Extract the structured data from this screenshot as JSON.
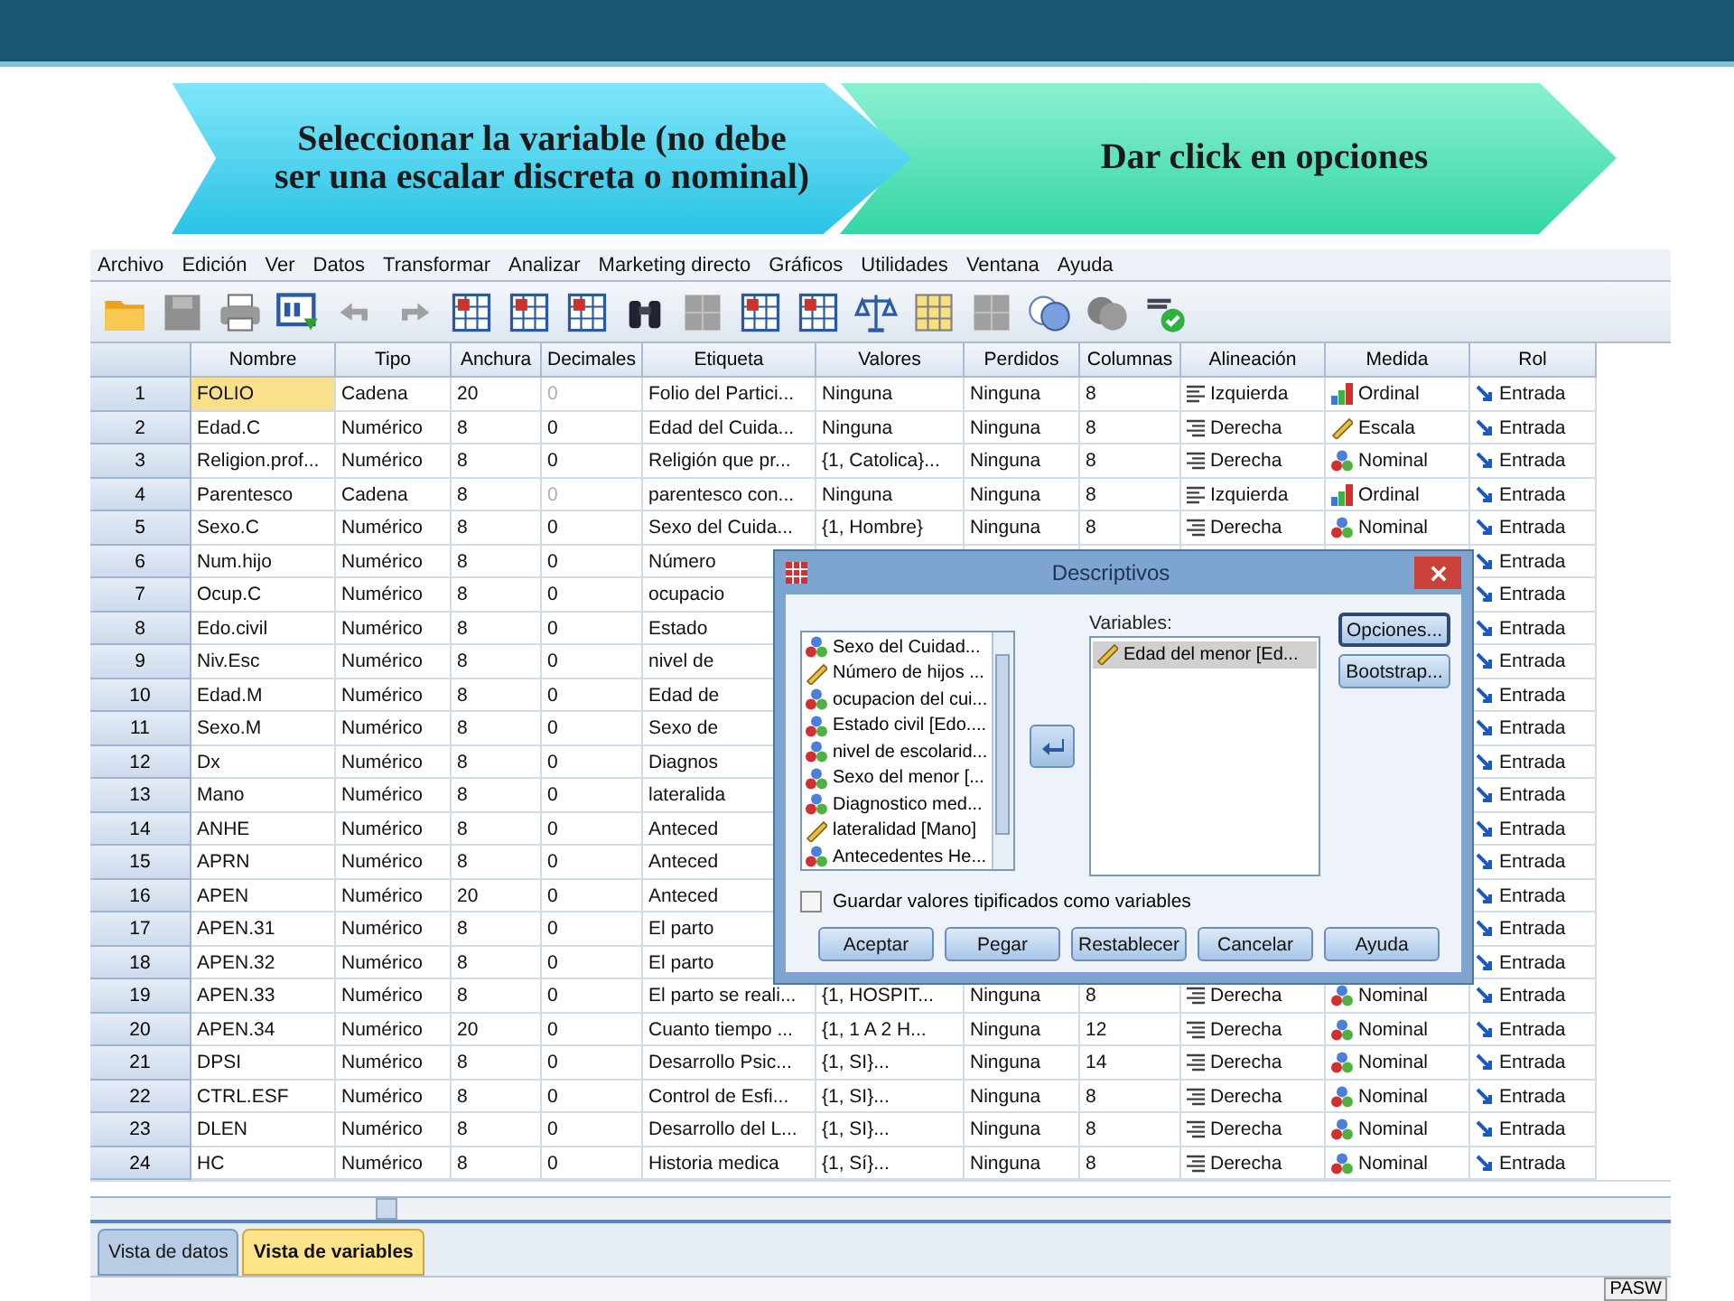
{
  "slide": {
    "steps": [
      {
        "text": "Seleccionar la variable (no debe ser una escalar discreta o nominal)",
        "kind": "cyan"
      },
      {
        "text": "Dar click en opciones",
        "kind": "green"
      }
    ]
  },
  "menu": [
    "Archivo",
    "Edición",
    "Ver",
    "Datos",
    "Transformar",
    "Analizar",
    "Marketing directo",
    "Gráficos",
    "Utilidades",
    "Ventana",
    "Ayuda"
  ],
  "table": {
    "columns": [
      "Nombre",
      "Tipo",
      "Anchura",
      "Decimales",
      "Etiqueta",
      "Valores",
      "Perdidos",
      "Columnas",
      "Alineación",
      "Medida",
      "Rol"
    ],
    "rows": [
      {
        "number": "1",
        "selected": true,
        "nombre": "FOLIO",
        "tipo": "Cadena",
        "anchura": "20",
        "decimales": {
          "text": "0",
          "dimmed": true
        },
        "etiqueta": "Folio del Partici...",
        "valores": "Ninguna",
        "perdidos": "Ninguna",
        "columnas": "8",
        "alineacion": {
          "text": "Izquierda",
          "kind": "left"
        },
        "medida": {
          "text": "Ordinal",
          "kind": "ordinal"
        },
        "rol": "Entrada"
      },
      {
        "number": "2",
        "selected": false,
        "nombre": "Edad.C",
        "tipo": "Numérico",
        "anchura": "8",
        "decimales": {
          "text": "0",
          "dimmed": false
        },
        "etiqueta": "Edad del Cuida...",
        "valores": "Ninguna",
        "perdidos": "Ninguna",
        "columnas": "8",
        "alineacion": {
          "text": "Derecha",
          "kind": "right"
        },
        "medida": {
          "text": "Escala",
          "kind": "scale"
        },
        "rol": "Entrada"
      },
      {
        "number": "3",
        "selected": false,
        "nombre": "Religion.prof...",
        "tipo": "Numérico",
        "anchura": "8",
        "decimales": {
          "text": "0",
          "dimmed": false
        },
        "etiqueta": "Religión que pr...",
        "valores": "{1, Catolica}...",
        "perdidos": "Ninguna",
        "columnas": "8",
        "alineacion": {
          "text": "Derecha",
          "kind": "right"
        },
        "medida": {
          "text": "Nominal",
          "kind": "nominal"
        },
        "rol": "Entrada"
      },
      {
        "number": "4",
        "selected": false,
        "nombre": "Parentesco",
        "tipo": "Cadena",
        "anchura": "8",
        "decimales": {
          "text": "0",
          "dimmed": true
        },
        "etiqueta": "parentesco con...",
        "valores": "Ninguna",
        "perdidos": "Ninguna",
        "columnas": "8",
        "alineacion": {
          "text": "Izquierda",
          "kind": "left"
        },
        "medida": {
          "text": "Ordinal",
          "kind": "ordinal"
        },
        "rol": "Entrada"
      },
      {
        "number": "5",
        "selected": false,
        "nombre": "Sexo.C",
        "tipo": "Numérico",
        "anchura": "8",
        "decimales": {
          "text": "0",
          "dimmed": false
        },
        "etiqueta": "Sexo del Cuida...",
        "valores": "{1, Hombre}",
        "perdidos": "Ninguna",
        "columnas": "8",
        "alineacion": {
          "text": "Derecha",
          "kind": "right"
        },
        "medida": {
          "text": "Nominal",
          "kind": "nominal"
        },
        "rol": "Entrada"
      },
      {
        "number": "6",
        "selected": false,
        "nombre": "Num.hijo",
        "tipo": "Numérico",
        "anchura": "8",
        "decimales": {
          "text": "0",
          "dimmed": false
        },
        "etiqueta": "Número",
        "rol": "Entrada"
      },
      {
        "number": "7",
        "selected": false,
        "nombre": "Ocup.C",
        "tipo": "Numérico",
        "anchura": "8",
        "decimales": {
          "text": "0",
          "dimmed": false
        },
        "etiqueta": "ocupacio",
        "rol": "Entrada"
      },
      {
        "number": "8",
        "selected": false,
        "nombre": "Edo.civil",
        "tipo": "Numérico",
        "anchura": "8",
        "decimales": {
          "text": "0",
          "dimmed": false
        },
        "etiqueta": "Estado",
        "rol": "Entrada"
      },
      {
        "number": "9",
        "selected": false,
        "nombre": "Niv.Esc",
        "tipo": "Numérico",
        "anchura": "8",
        "decimales": {
          "text": "0",
          "dimmed": false
        },
        "etiqueta": "nivel de",
        "rol": "Entrada"
      },
      {
        "number": "10",
        "selected": false,
        "nombre": "Edad.M",
        "tipo": "Numérico",
        "anchura": "8",
        "decimales": {
          "text": "0",
          "dimmed": false
        },
        "etiqueta": "Edad de",
        "rol": "Entrada"
      },
      {
        "number": "11",
        "selected": false,
        "nombre": "Sexo.M",
        "tipo": "Numérico",
        "anchura": "8",
        "decimales": {
          "text": "0",
          "dimmed": false
        },
        "etiqueta": "Sexo de",
        "rol": "Entrada"
      },
      {
        "number": "12",
        "selected": false,
        "nombre": "Dx",
        "tipo": "Numérico",
        "anchura": "8",
        "decimales": {
          "text": "0",
          "dimmed": false
        },
        "etiqueta": "Diagnos",
        "rol": "Entrada"
      },
      {
        "number": "13",
        "selected": false,
        "nombre": "Mano",
        "tipo": "Numérico",
        "anchura": "8",
        "decimales": {
          "text": "0",
          "dimmed": false
        },
        "etiqueta": "lateralida",
        "rol": "Entrada"
      },
      {
        "number": "14",
        "selected": false,
        "nombre": "ANHE",
        "tipo": "Numérico",
        "anchura": "8",
        "decimales": {
          "text": "0",
          "dimmed": false
        },
        "etiqueta": "Anteced",
        "rol": "Entrada"
      },
      {
        "number": "15",
        "selected": false,
        "nombre": "APRN",
        "tipo": "Numérico",
        "anchura": "8",
        "decimales": {
          "text": "0",
          "dimmed": false
        },
        "etiqueta": "Anteced",
        "rol": "Entrada"
      },
      {
        "number": "16",
        "selected": false,
        "nombre": "APEN",
        "tipo": "Numérico",
        "anchura": "20",
        "decimales": {
          "text": "0",
          "dimmed": false
        },
        "etiqueta": "Anteced",
        "rol": "Entrada"
      },
      {
        "number": "17",
        "selected": false,
        "nombre": "APEN.31",
        "tipo": "Numérico",
        "anchura": "8",
        "decimales": {
          "text": "0",
          "dimmed": false
        },
        "etiqueta": "El parto",
        "rol": "Entrada"
      },
      {
        "number": "18",
        "selected": false,
        "nombre": "APEN.32",
        "tipo": "Numérico",
        "anchura": "8",
        "decimales": {
          "text": "0",
          "dimmed": false
        },
        "etiqueta": "El parto",
        "rol": "Entrada"
      },
      {
        "number": "19",
        "selected": false,
        "nombre": "APEN.33",
        "tipo": "Numérico",
        "anchura": "8",
        "decimales": {
          "text": "0",
          "dimmed": false
        },
        "etiqueta": "El parto se reali...",
        "valores": "{1, HOSPIT...",
        "perdidos": "Ninguna",
        "columnas": "8",
        "alineacion": {
          "text": "Derecha",
          "kind": "right"
        },
        "medida": {
          "text": "Nominal",
          "kind": "nominal"
        },
        "rol": "Entrada"
      },
      {
        "number": "20",
        "selected": false,
        "nombre": "APEN.34",
        "tipo": "Numérico",
        "anchura": "20",
        "decimales": {
          "text": "0",
          "dimmed": false
        },
        "etiqueta": "Cuanto tiempo ...",
        "valores": "{1, 1 A 2 H...",
        "perdidos": "Ninguna",
        "columnas": "12",
        "alineacion": {
          "text": "Derecha",
          "kind": "right"
        },
        "medida": {
          "text": "Nominal",
          "kind": "nominal"
        },
        "rol": "Entrada"
      },
      {
        "number": "21",
        "selected": false,
        "nombre": "DPSI",
        "tipo": "Numérico",
        "anchura": "8",
        "decimales": {
          "text": "0",
          "dimmed": false
        },
        "etiqueta": "Desarrollo Psic...",
        "valores": "{1, SI}...",
        "perdidos": "Ninguna",
        "columnas": "14",
        "alineacion": {
          "text": "Derecha",
          "kind": "right"
        },
        "medida": {
          "text": "Nominal",
          "kind": "nominal"
        },
        "rol": "Entrada"
      },
      {
        "number": "22",
        "selected": false,
        "nombre": "CTRL.ESF",
        "tipo": "Numérico",
        "anchura": "8",
        "decimales": {
          "text": "0",
          "dimmed": false
        },
        "etiqueta": "Control de Esfi...",
        "valores": "{1, SI}...",
        "perdidos": "Ninguna",
        "columnas": "8",
        "alineacion": {
          "text": "Derecha",
          "kind": "right"
        },
        "medida": {
          "text": "Nominal",
          "kind": "nominal"
        },
        "rol": "Entrada"
      },
      {
        "number": "23",
        "selected": false,
        "nombre": "DLEN",
        "tipo": "Numérico",
        "anchura": "8",
        "decimales": {
          "text": "0",
          "dimmed": false
        },
        "etiqueta": "Desarrollo del L...",
        "valores": "{1, SI}...",
        "perdidos": "Ninguna",
        "columnas": "8",
        "alineacion": {
          "text": "Derecha",
          "kind": "right"
        },
        "medida": {
          "text": "Nominal",
          "kind": "nominal"
        },
        "rol": "Entrada"
      },
      {
        "number": "24",
        "selected": false,
        "nombre": "HC",
        "tipo": "Numérico",
        "anchura": "8",
        "decimales": {
          "text": "0",
          "dimmed": false
        },
        "etiqueta": "Historia medica",
        "valores": "{1, Sí}...",
        "perdidos": "Ninguna",
        "columnas": "8",
        "alineacion": {
          "text": "Derecha",
          "kind": "right"
        },
        "medida": {
          "text": "Nominal",
          "kind": "nominal"
        },
        "rol": "Entrada"
      }
    ]
  },
  "view_tabs": [
    {
      "label": "Vista de datos",
      "selected": false
    },
    {
      "label": "Vista de variables",
      "selected": true
    }
  ],
  "status_bar": {
    "text": "PASW"
  },
  "dialog": {
    "title": "Descriptivos",
    "source_items": [
      {
        "text": "Sexo del Cuidad...",
        "kind": "nominal"
      },
      {
        "text": "Número de hijos ...",
        "kind": "scale"
      },
      {
        "text": "ocupacion del cui...",
        "kind": "nominal"
      },
      {
        "text": "Estado civil [Edo....",
        "kind": "nominal"
      },
      {
        "text": "nivel de escolarid...",
        "kind": "nominal"
      },
      {
        "text": "Sexo del menor [...",
        "kind": "nominal"
      },
      {
        "text": "Diagnostico med...",
        "kind": "nominal"
      },
      {
        "text": "lateralidad [Mano]",
        "kind": "scale"
      },
      {
        "text": "Antecedentes He...",
        "kind": "nominal"
      }
    ],
    "variables_label": "Variables:",
    "target_items": [
      {
        "text": "Edad del menor [Ed...",
        "kind": "scale",
        "selected": true
      }
    ],
    "side_buttons": [
      "Opciones...",
      "Bootstrap..."
    ],
    "checkbox": {
      "label": "Guardar valores tipificados como variables",
      "checked": false
    },
    "buttons": [
      "Aceptar",
      "Pegar",
      "Restablecer",
      "Cancelar",
      "Ayuda"
    ]
  }
}
